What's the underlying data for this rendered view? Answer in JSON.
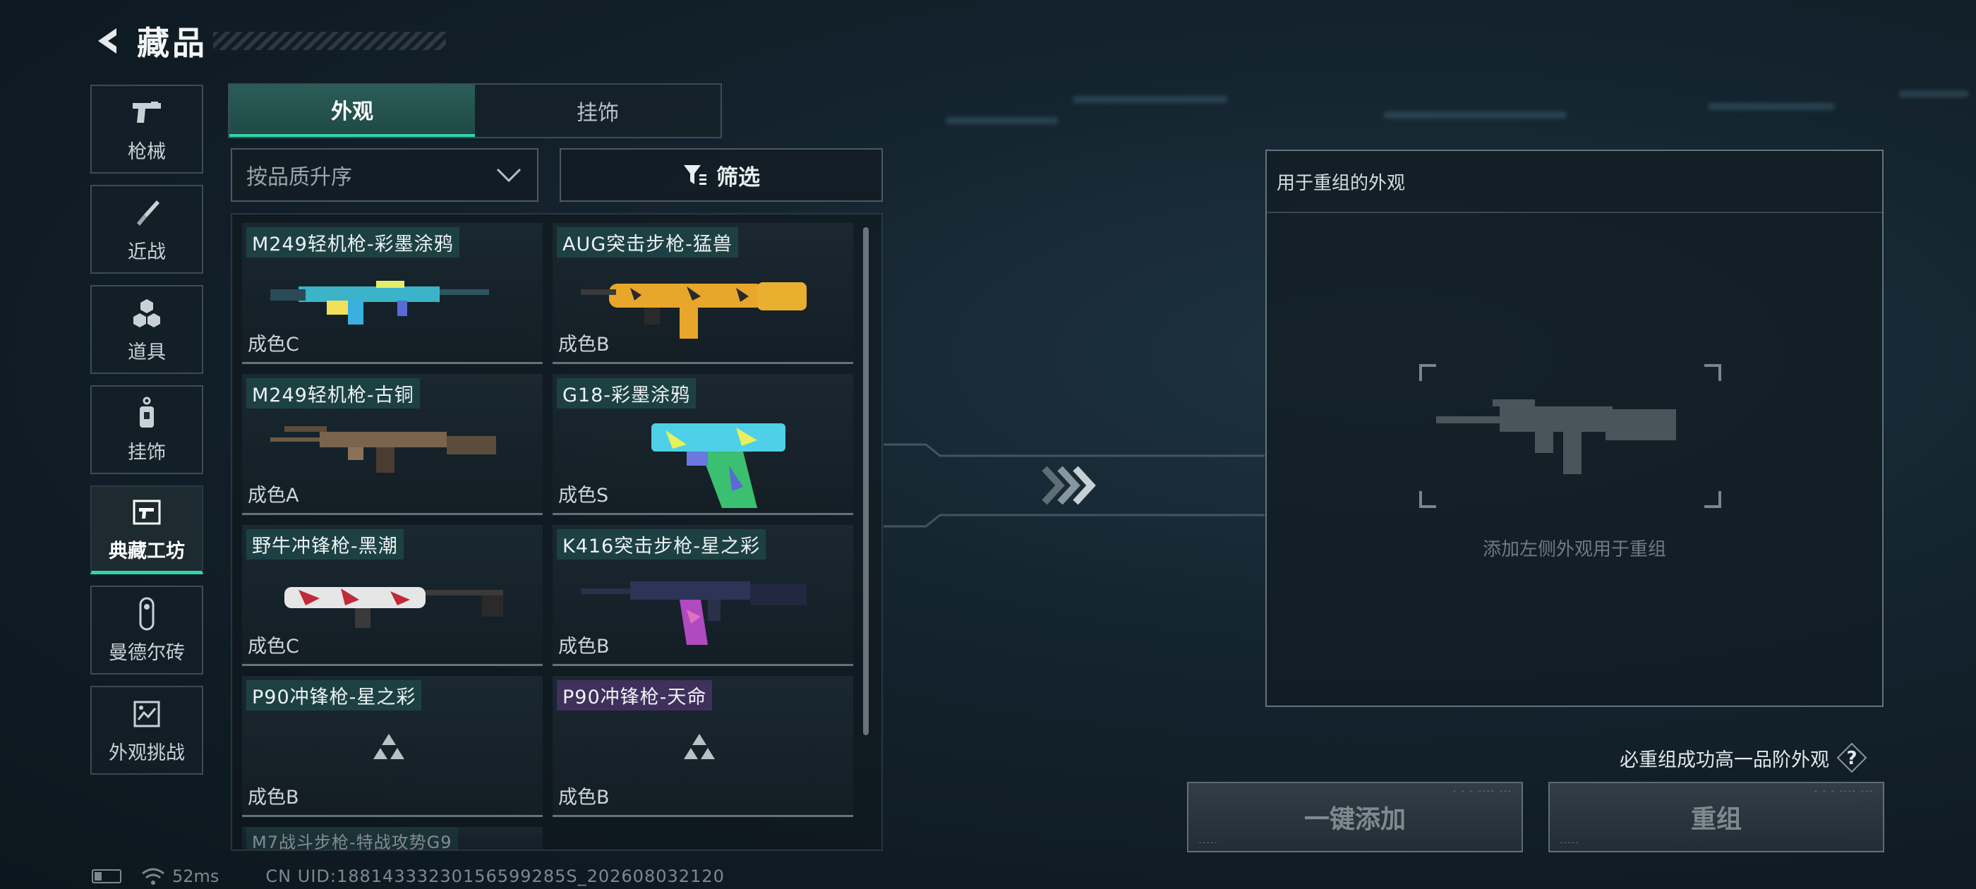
{
  "header": {
    "title": "藏品"
  },
  "nav": [
    {
      "id": "guns",
      "label": "枪械",
      "icon": "pistol-icon"
    },
    {
      "id": "melee",
      "label": "近战",
      "icon": "knife-icon"
    },
    {
      "id": "items",
      "label": "道具",
      "icon": "hexagon-cluster-icon"
    },
    {
      "id": "charms",
      "label": "挂饰",
      "icon": "charm-icon"
    },
    {
      "id": "workshop",
      "label": "典藏工坊",
      "icon": "workshop-icon",
      "active": true
    },
    {
      "id": "mandel",
      "label": "曼德尔砖",
      "icon": "mandel-brick-icon"
    },
    {
      "id": "challenge",
      "label": "外观挑战",
      "icon": "challenge-icon"
    }
  ],
  "tabs": [
    {
      "label": "外观",
      "active": true
    },
    {
      "label": "挂饰",
      "active": false
    }
  ],
  "sort": {
    "value": "按品质升序"
  },
  "filter": {
    "label": "筛选"
  },
  "skins": [
    {
      "name": "M249轻机枪-彩墨涂鸦",
      "grade": "成色C",
      "weapon": "m249-graffiti"
    },
    {
      "name": "AUG突击步枪-猛兽",
      "grade": "成色B",
      "weapon": "aug-beast"
    },
    {
      "name": "M249轻机枪-古铜",
      "grade": "成色A",
      "weapon": "m249-bronze"
    },
    {
      "name": "G18-彩墨涂鸦",
      "grade": "成色S",
      "weapon": "g18-graffiti"
    },
    {
      "name": "野牛冲锋枪-黑潮",
      "grade": "成色C",
      "weapon": "bizon-blacktide"
    },
    {
      "name": "K416突击步枪-星之彩",
      "grade": "成色B",
      "weapon": "k416-star"
    },
    {
      "name": "P90冲锋枪-星之彩",
      "grade": "成色B",
      "weapon": "placeholder"
    },
    {
      "name": "P90冲锋枪-天命",
      "grade": "成色B",
      "weapon": "placeholder"
    }
  ],
  "partial_skin": {
    "name": "M7战斗步枪-特战攻势G9"
  },
  "recombine": {
    "header": "用于重组的外观",
    "hint": "添加左侧外观用于重组"
  },
  "guarantee": {
    "text": "必重组成功高一品阶外观",
    "help": "?"
  },
  "buttons": {
    "add_all": "一键添加",
    "recombine": "重组"
  },
  "status": {
    "ping": "52ms",
    "uid": "CN UID:18814333230156599285S_202608032120"
  },
  "colors": {
    "accent": "#2fd6a9",
    "panel": "#13222c"
  }
}
